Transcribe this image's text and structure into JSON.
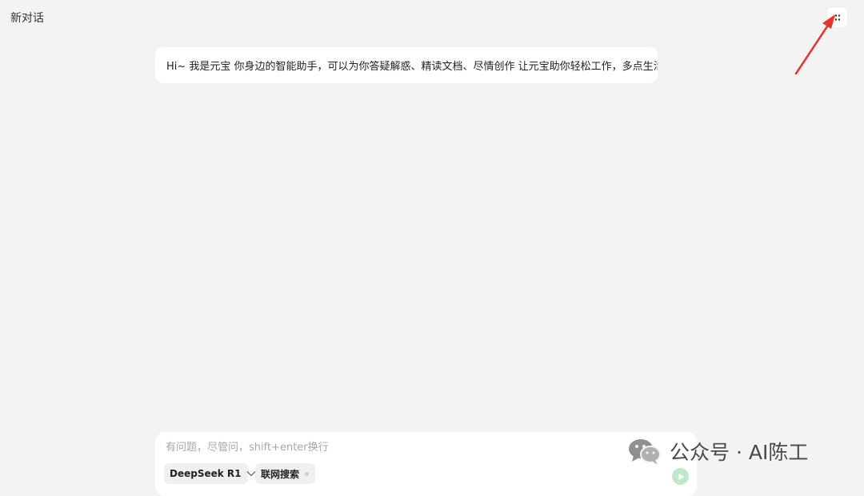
{
  "header": {
    "title": "新对话",
    "more_icon": "dots-grid-icon"
  },
  "greeting": {
    "text": "Hi~ 我是元宝 你身边的智能助手，可以为你答疑解惑、精读文档、尽情创作 让元宝助你轻松工作，多点生活"
  },
  "composer": {
    "placeholder": "有问题，尽管问，shift+enter换行",
    "model_label": "DeepSeek R1",
    "model_icon": "chevron-down-icon",
    "search_label": "联网搜索",
    "send_icon": "send-icon"
  },
  "watermark": {
    "text": "公众号 · AI陈工",
    "logo": "wechat-icon"
  },
  "colors": {
    "background": "#f3f3f3",
    "surface": "#ffffff",
    "chip": "#f0f0f0",
    "send": "#bfe8c9",
    "arrow": "#e8332a"
  }
}
